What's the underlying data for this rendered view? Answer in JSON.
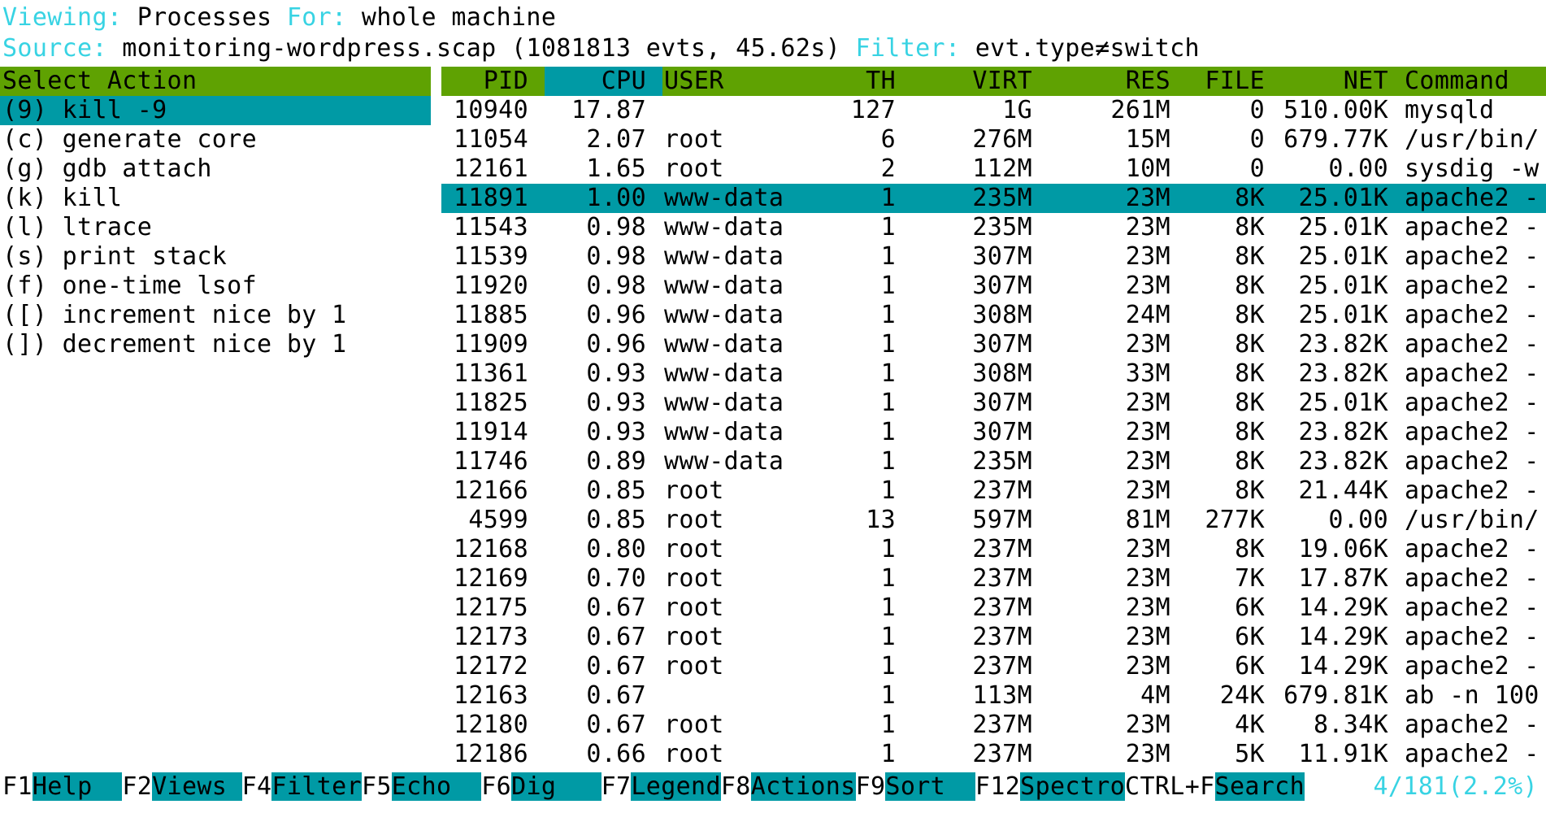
{
  "header": {
    "viewing_label": "Viewing: ",
    "viewing_value": "Processes ",
    "for_label": "For: ",
    "for_value": "whole machine",
    "source_label": "Source: ",
    "source_value": "monitoring-wordpress.scap (1081813 evts, 45.62s) ",
    "filter_label": "Filter: ",
    "filter_value": "evt.type≠switch"
  },
  "action_panel": {
    "title": "Select Action",
    "items": [
      {
        "key": "(9)",
        "label": "kill -9",
        "selected": true
      },
      {
        "key": "(c)",
        "label": "generate core",
        "selected": false
      },
      {
        "key": "(g)",
        "label": "gdb attach",
        "selected": false
      },
      {
        "key": "(k)",
        "label": "kill",
        "selected": false
      },
      {
        "key": "(l)",
        "label": "ltrace",
        "selected": false
      },
      {
        "key": "(s)",
        "label": "print stack",
        "selected": false
      },
      {
        "key": "(f)",
        "label": "one-time lsof",
        "selected": false
      },
      {
        "key": "([)",
        "label": "increment nice by 1",
        "selected": false
      },
      {
        "key": "(])",
        "label": "decrement nice by 1",
        "selected": false
      }
    ]
  },
  "process_table": {
    "columns": [
      "PID",
      "CPU",
      "USER",
      "TH",
      "VIRT",
      "RES",
      "FILE",
      "NET",
      "Command"
    ],
    "sorted_column": "CPU",
    "rows": [
      {
        "pid": "10940",
        "cpu": "17.87",
        "user": "",
        "th": "127",
        "virt": "1G",
        "res": "261M",
        "file": "0",
        "net": "510.00K",
        "command": "mysqld",
        "selected": false
      },
      {
        "pid": "11054",
        "cpu": "2.07",
        "user": "root",
        "th": "6",
        "virt": "276M",
        "res": "15M",
        "file": "0",
        "net": "679.77K",
        "command": "/usr/bin/",
        "selected": false
      },
      {
        "pid": "12161",
        "cpu": "1.65",
        "user": "root",
        "th": "2",
        "virt": "112M",
        "res": "10M",
        "file": "0",
        "net": "0.00",
        "command": "sysdig -w",
        "selected": false
      },
      {
        "pid": "11891",
        "cpu": "1.00",
        "user": "www-data",
        "th": "1",
        "virt": "235M",
        "res": "23M",
        "file": "8K",
        "net": "25.01K",
        "command": "apache2 -",
        "selected": true
      },
      {
        "pid": "11543",
        "cpu": "0.98",
        "user": "www-data",
        "th": "1",
        "virt": "235M",
        "res": "23M",
        "file": "8K",
        "net": "25.01K",
        "command": "apache2 -",
        "selected": false
      },
      {
        "pid": "11539",
        "cpu": "0.98",
        "user": "www-data",
        "th": "1",
        "virt": "307M",
        "res": "23M",
        "file": "8K",
        "net": "25.01K",
        "command": "apache2 -",
        "selected": false
      },
      {
        "pid": "11920",
        "cpu": "0.98",
        "user": "www-data",
        "th": "1",
        "virt": "307M",
        "res": "23M",
        "file": "8K",
        "net": "25.01K",
        "command": "apache2 -",
        "selected": false
      },
      {
        "pid": "11885",
        "cpu": "0.96",
        "user": "www-data",
        "th": "1",
        "virt": "308M",
        "res": "24M",
        "file": "8K",
        "net": "25.01K",
        "command": "apache2 -",
        "selected": false
      },
      {
        "pid": "11909",
        "cpu": "0.96",
        "user": "www-data",
        "th": "1",
        "virt": "307M",
        "res": "23M",
        "file": "8K",
        "net": "23.82K",
        "command": "apache2 -",
        "selected": false
      },
      {
        "pid": "11361",
        "cpu": "0.93",
        "user": "www-data",
        "th": "1",
        "virt": "308M",
        "res": "33M",
        "file": "8K",
        "net": "23.82K",
        "command": "apache2 -",
        "selected": false
      },
      {
        "pid": "11825",
        "cpu": "0.93",
        "user": "www-data",
        "th": "1",
        "virt": "307M",
        "res": "23M",
        "file": "8K",
        "net": "25.01K",
        "command": "apache2 -",
        "selected": false
      },
      {
        "pid": "11914",
        "cpu": "0.93",
        "user": "www-data",
        "th": "1",
        "virt": "307M",
        "res": "23M",
        "file": "8K",
        "net": "23.82K",
        "command": "apache2 -",
        "selected": false
      },
      {
        "pid": "11746",
        "cpu": "0.89",
        "user": "www-data",
        "th": "1",
        "virt": "235M",
        "res": "23M",
        "file": "8K",
        "net": "23.82K",
        "command": "apache2 -",
        "selected": false
      },
      {
        "pid": "12166",
        "cpu": "0.85",
        "user": "root",
        "th": "1",
        "virt": "237M",
        "res": "23M",
        "file": "8K",
        "net": "21.44K",
        "command": "apache2 -",
        "selected": false
      },
      {
        "pid": "4599",
        "cpu": "0.85",
        "user": "root",
        "th": "13",
        "virt": "597M",
        "res": "81M",
        "file": "277K",
        "net": "0.00",
        "command": "/usr/bin/",
        "selected": false
      },
      {
        "pid": "12168",
        "cpu": "0.80",
        "user": "root",
        "th": "1",
        "virt": "237M",
        "res": "23M",
        "file": "8K",
        "net": "19.06K",
        "command": "apache2 -",
        "selected": false
      },
      {
        "pid": "12169",
        "cpu": "0.70",
        "user": "root",
        "th": "1",
        "virt": "237M",
        "res": "23M",
        "file": "7K",
        "net": "17.87K",
        "command": "apache2 -",
        "selected": false
      },
      {
        "pid": "12175",
        "cpu": "0.67",
        "user": "root",
        "th": "1",
        "virt": "237M",
        "res": "23M",
        "file": "6K",
        "net": "14.29K",
        "command": "apache2 -",
        "selected": false
      },
      {
        "pid": "12173",
        "cpu": "0.67",
        "user": "root",
        "th": "1",
        "virt": "237M",
        "res": "23M",
        "file": "6K",
        "net": "14.29K",
        "command": "apache2 -",
        "selected": false
      },
      {
        "pid": "12172",
        "cpu": "0.67",
        "user": "root",
        "th": "1",
        "virt": "237M",
        "res": "23M",
        "file": "6K",
        "net": "14.29K",
        "command": "apache2 -",
        "selected": false
      },
      {
        "pid": "12163",
        "cpu": "0.67",
        "user": "",
        "th": "1",
        "virt": "113M",
        "res": "4M",
        "file": "24K",
        "net": "679.81K",
        "command": "ab -n 100",
        "selected": false
      },
      {
        "pid": "12180",
        "cpu": "0.67",
        "user": "root",
        "th": "1",
        "virt": "237M",
        "res": "23M",
        "file": "4K",
        "net": "8.34K",
        "command": "apache2 -",
        "selected": false
      },
      {
        "pid": "12186",
        "cpu": "0.66",
        "user": "root",
        "th": "1",
        "virt": "237M",
        "res": "23M",
        "file": "5K",
        "net": "11.91K",
        "command": "apache2 -",
        "selected": false
      }
    ]
  },
  "function_bar": {
    "segments": [
      {
        "key": "F1",
        "label": "Help  "
      },
      {
        "key": "F2",
        "label": "Views "
      },
      {
        "key": "F4",
        "label": "Filter"
      },
      {
        "key": "F5",
        "label": "Echo  "
      },
      {
        "key": "F6",
        "label": "Dig   "
      },
      {
        "key": "F7",
        "label": "Legend"
      },
      {
        "key": "F8",
        "label": "Actions"
      },
      {
        "key": "F9",
        "label": "Sort  "
      },
      {
        "key": "F12",
        "label": "Spectro"
      },
      {
        "key": "CTRL+F",
        "label": "Search"
      }
    ],
    "counter": "4/181(2.2%)"
  },
  "colors": {
    "header_green": "#5fa202",
    "highlight_teal": "#009aa5",
    "label_cyan": "#38d3e3"
  }
}
